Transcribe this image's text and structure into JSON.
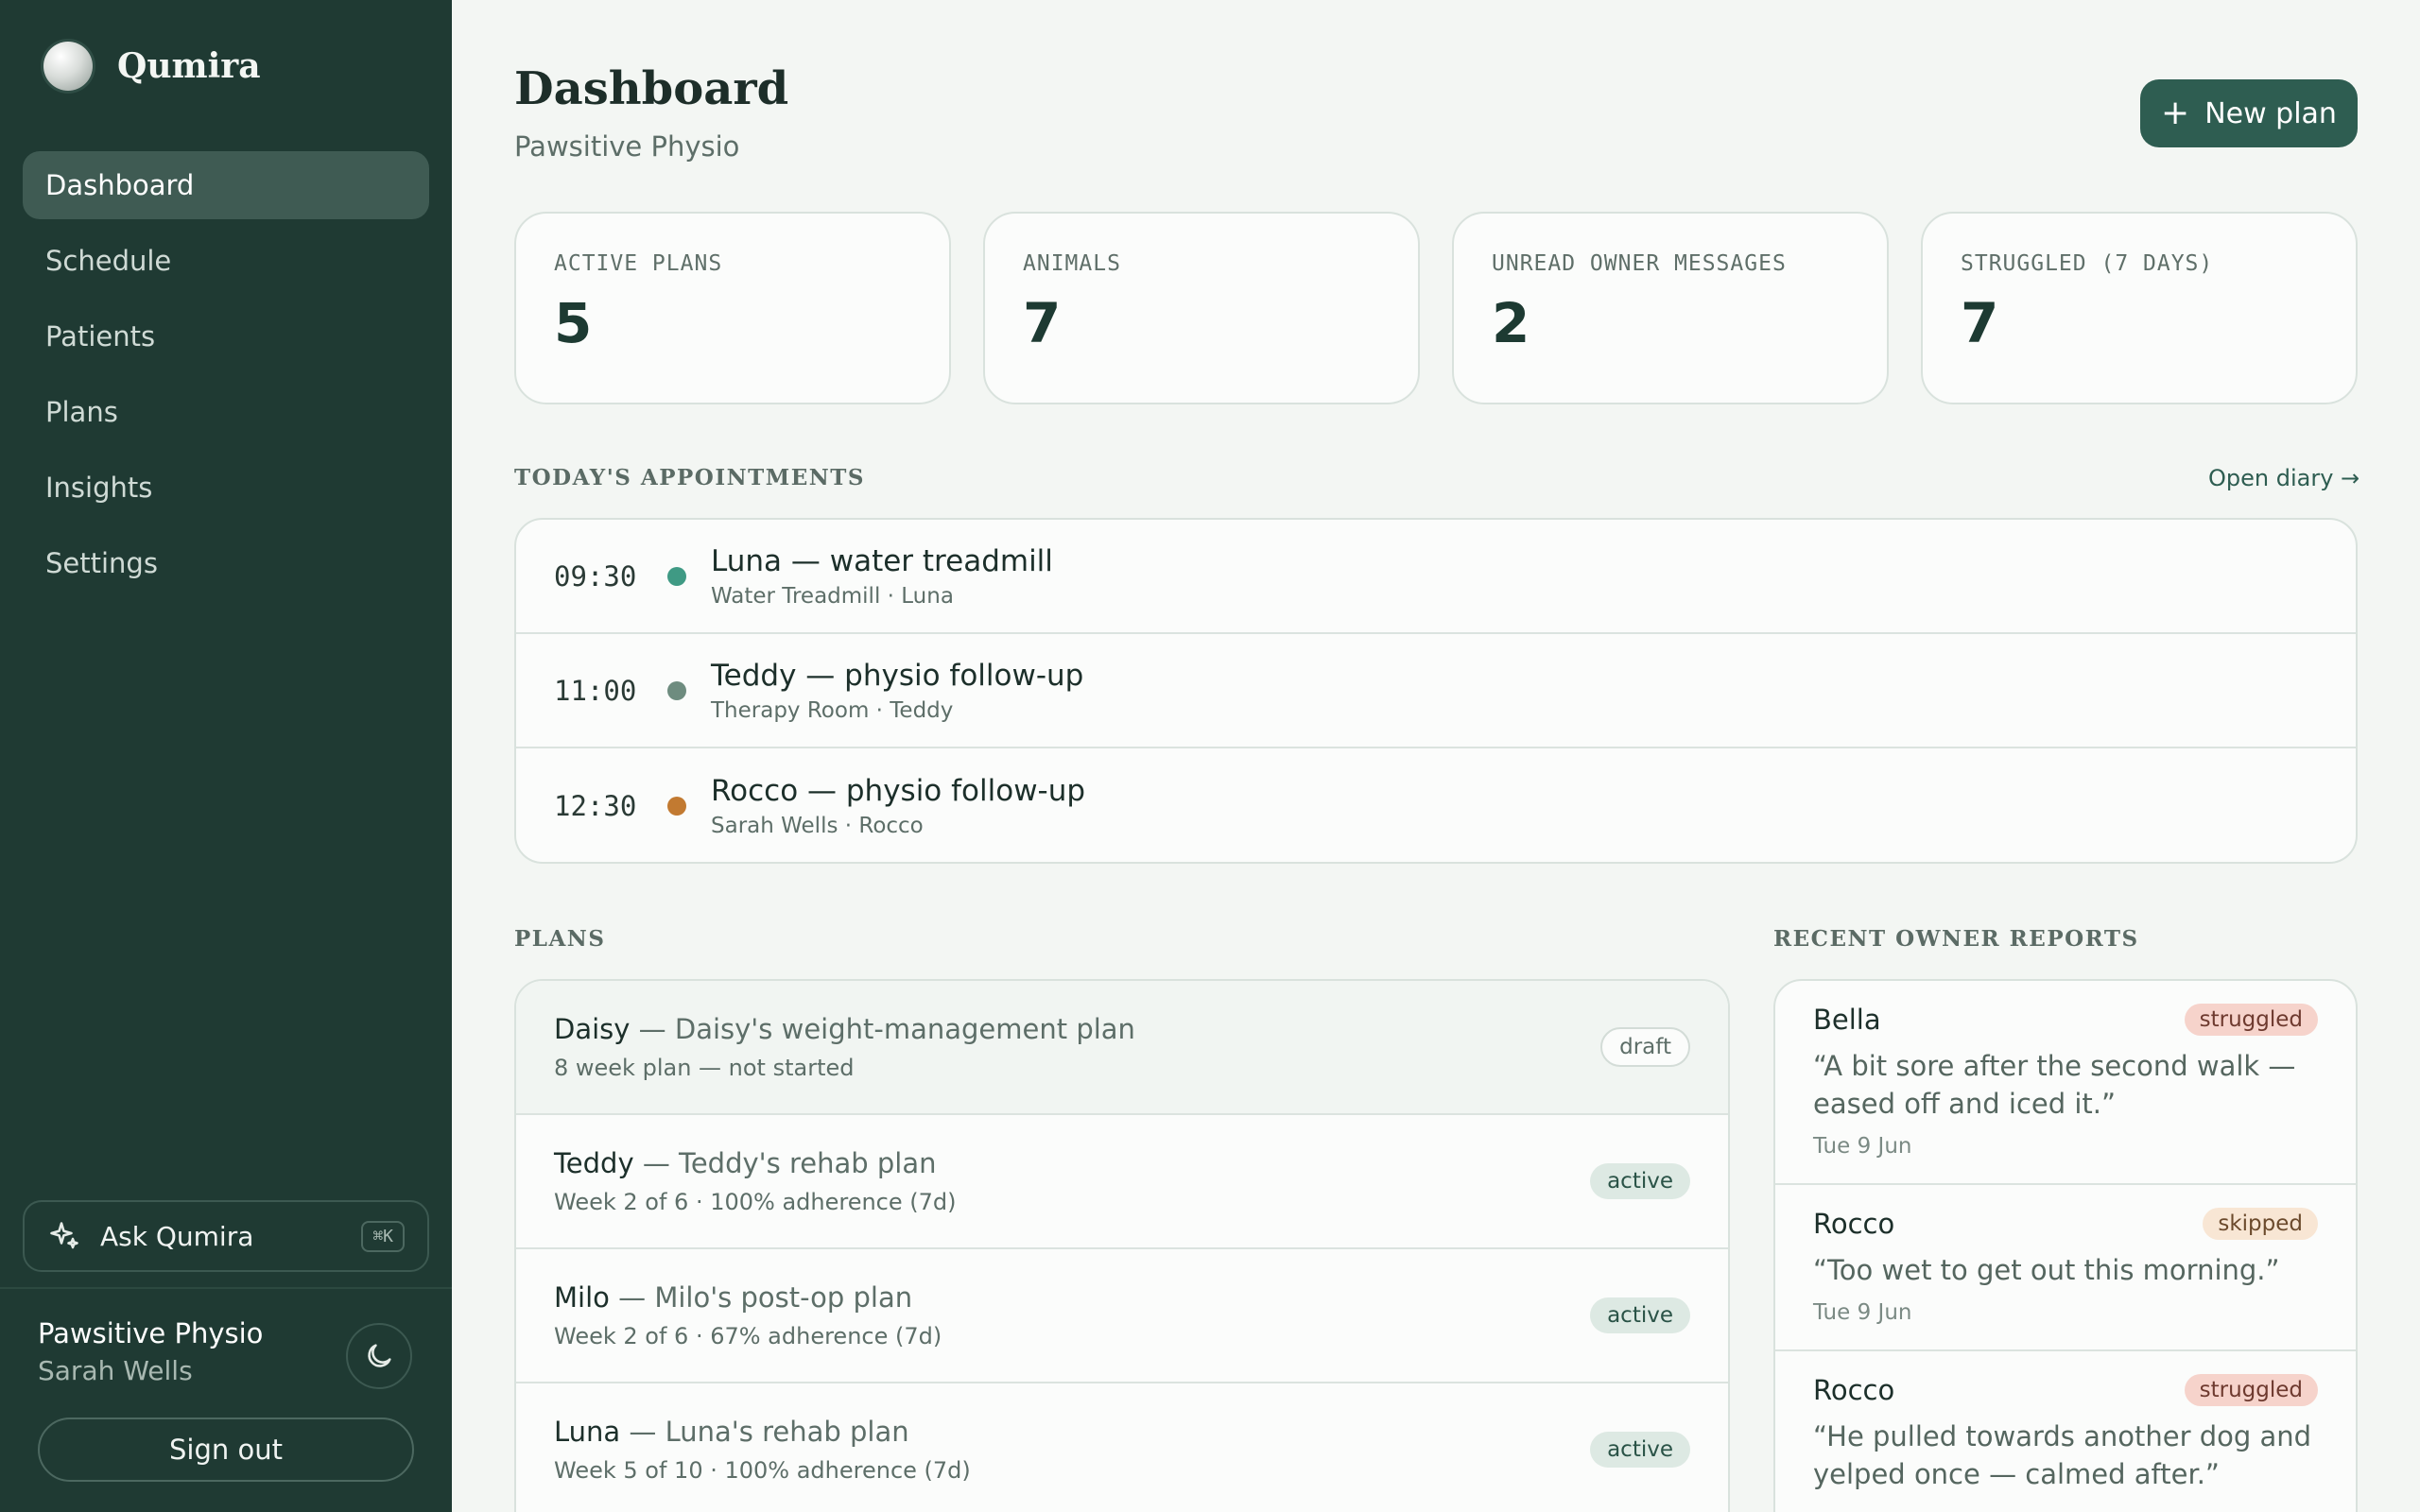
{
  "brand": {
    "name": "Qumira"
  },
  "nav": {
    "items": [
      {
        "label": "Dashboard"
      },
      {
        "label": "Schedule"
      },
      {
        "label": "Patients"
      },
      {
        "label": "Plans"
      },
      {
        "label": "Insights"
      },
      {
        "label": "Settings"
      }
    ],
    "active": "Dashboard"
  },
  "ask": {
    "label": "Ask Qumira",
    "shortcut": "⌘K"
  },
  "account": {
    "org": "Pawsitive Physio",
    "user": "Sarah Wells",
    "signout_label": "Sign out"
  },
  "header": {
    "title": "Dashboard",
    "subtitle": "Pawsitive Physio",
    "new_plan_label": "New plan"
  },
  "stats": [
    {
      "label": "ACTIVE PLANS",
      "value": "5"
    },
    {
      "label": "ANIMALS",
      "value": "7"
    },
    {
      "label": "UNREAD OWNER MESSAGES",
      "value": "2"
    },
    {
      "label": "STRUGGLED (7 DAYS)",
      "value": "7"
    }
  ],
  "appointments": {
    "section_title": "TODAY'S APPOINTMENTS",
    "open_diary_label": "Open diary →",
    "items": [
      {
        "time": "09:30",
        "title": "Luna — water treadmill",
        "sub": "Water Treadmill · Luna",
        "dot_color": "#3f9a84"
      },
      {
        "time": "11:00",
        "title": "Teddy — physio follow-up",
        "sub": "Therapy Room · Teddy",
        "dot_color": "#6e8c7f"
      },
      {
        "time": "12:30",
        "title": "Rocco — physio follow-up",
        "sub": "Sarah Wells · Rocco",
        "dot_color": "#c27a31"
      }
    ]
  },
  "plans": {
    "section_title": "PLANS",
    "items": [
      {
        "name": "Daisy",
        "plan": " — Daisy's weight-management plan",
        "meta": "8 week plan — not started",
        "status": "draft"
      },
      {
        "name": "Teddy",
        "plan": " — Teddy's rehab plan",
        "meta": "Week 2 of 6 · 100% adherence (7d)",
        "status": "active"
      },
      {
        "name": "Milo",
        "plan": " — Milo's post-op plan",
        "meta": "Week 2 of 6 · 67% adherence (7d)",
        "status": "active"
      },
      {
        "name": "Luna",
        "plan": " — Luna's rehab plan",
        "meta": "Week 5 of 10 · 100% adherence (7d)",
        "status": "active"
      }
    ]
  },
  "reports": {
    "section_title": "RECENT OWNER REPORTS",
    "items": [
      {
        "name": "Bella",
        "tag": "struggled",
        "quote": "“A bit sore after the second walk — eased off and iced it.”",
        "date": "Tue 9 Jun"
      },
      {
        "name": "Rocco",
        "tag": "skipped",
        "quote": "“Too wet to get out this morning.”",
        "date": "Tue 9 Jun"
      },
      {
        "name": "Rocco",
        "tag": "struggled",
        "quote": "“He pulled towards another dog and yelped once — calmed after.”",
        "date": ""
      }
    ]
  },
  "colors": {
    "sidebar": "#1f3a33",
    "accent": "#2e5d51",
    "background": "#f3f6f3"
  }
}
